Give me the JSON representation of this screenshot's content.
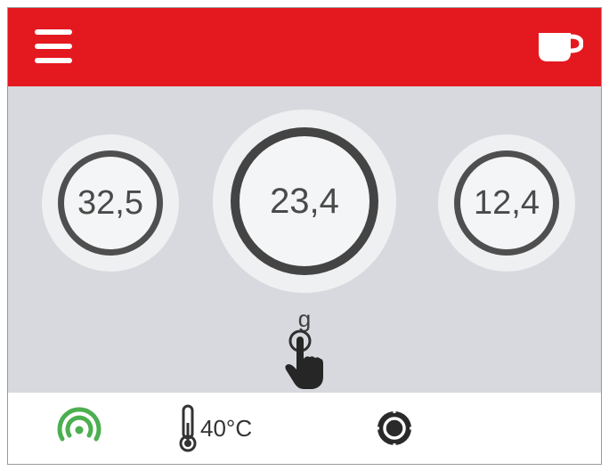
{
  "header": {
    "menu_icon": "hamburger-menu-icon",
    "drink_icon": "coffee-cup-icon",
    "background_color": "#e4191f"
  },
  "doses": [
    {
      "value": "32,5",
      "size": "small"
    },
    {
      "value": "23,4",
      "size": "large",
      "selected": true
    },
    {
      "value": "12,4",
      "size": "small"
    }
  ],
  "unit": "g",
  "touch_hint_icon": "finger-tap-icon",
  "footer": {
    "wifi_icon": "wifi-signal-icon",
    "wifi_color": "#4caf50",
    "thermometer_icon": "thermometer-icon",
    "temperature": "40°C",
    "target_icon": "target-settings-icon"
  }
}
